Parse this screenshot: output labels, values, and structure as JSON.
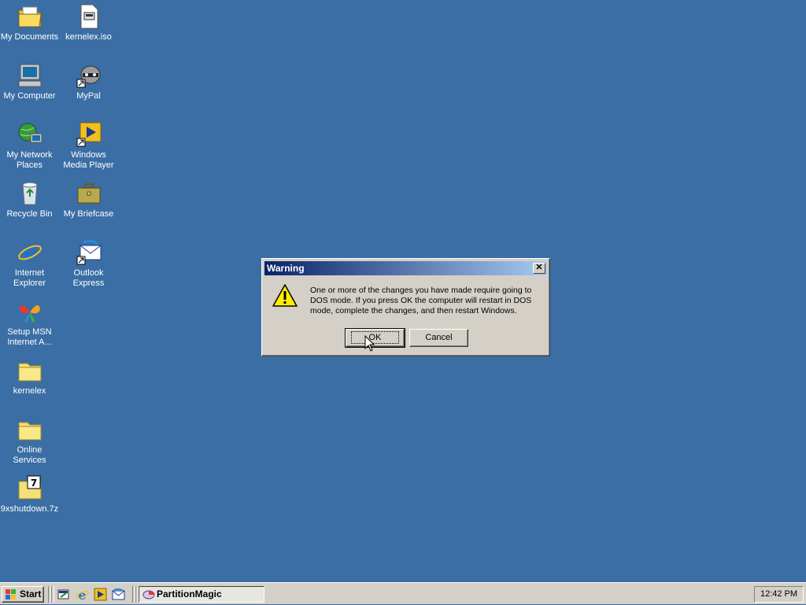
{
  "desktop": {
    "icons": [
      {
        "label": "My Documents",
        "icon": "my-documents-icon"
      },
      {
        "label": "kernelex.iso",
        "icon": "iso-file-icon"
      },
      {
        "label": "My Computer",
        "icon": "my-computer-icon"
      },
      {
        "label": "MyPal",
        "icon": "mypal-raccoon-icon"
      },
      {
        "label": "My Network Places",
        "icon": "network-places-icon"
      },
      {
        "label": "Windows Media Player",
        "icon": "media-player-icon"
      },
      {
        "label": "Recycle Bin",
        "icon": "recycle-bin-icon"
      },
      {
        "label": "My Briefcase",
        "icon": "briefcase-icon"
      },
      {
        "label": "Internet Explorer",
        "icon": "internet-explorer-icon"
      },
      {
        "label": "Outlook Express",
        "icon": "outlook-express-icon"
      },
      {
        "label": "Setup MSN Internet A...",
        "icon": "msn-butterfly-icon"
      },
      {
        "label": "kernelex",
        "icon": "folder-icon"
      },
      {
        "label": "Online Services",
        "icon": "folder-icon"
      },
      {
        "label": "9xshutdown.7z",
        "icon": "7z-archive-icon"
      }
    ]
  },
  "dialog": {
    "title": "Warning",
    "close_label": "✕",
    "icon": "warning-icon",
    "message": "One or more of the changes you have made require going to DOS mode. If you press OK the computer will restart in DOS mode, complete the changes, and then restart Windows.",
    "ok_label": "OK",
    "cancel_label": "Cancel"
  },
  "taskbar": {
    "start_label": "Start",
    "quick_launch": [
      "show-desktop-icon",
      "internet-explorer-icon",
      "media-player-icon",
      "outlook-express-icon"
    ],
    "task_label": "PartitionMagic",
    "clock": "12:42 PM"
  },
  "colors": {
    "desktop": "#3a6ea5",
    "title_start": "#0a246a",
    "title_end": "#a6caf0",
    "face": "#d4d0c8"
  }
}
